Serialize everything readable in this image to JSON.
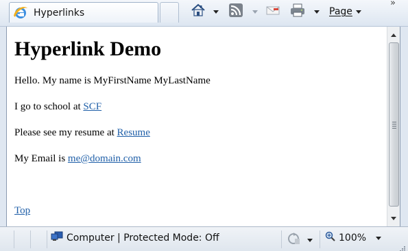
{
  "tab": {
    "title": "Hyperlinks",
    "icon": "ie-icon"
  },
  "toolbar": {
    "page_label": "Page",
    "overflow": "»",
    "icons": [
      "home-icon",
      "rss-feed-icon",
      "read-mail-icon",
      "print-icon"
    ]
  },
  "document": {
    "heading": "Hyperlink Demo",
    "intro": "Hello. My name is MyFirstName MyLastName",
    "school_prefix": "I go to school at ",
    "school_link": "SCF",
    "resume_prefix": "Please see my resume at ",
    "resume_link": "Resume",
    "email_prefix": "My Email is ",
    "email_link": "me@domain.com",
    "top_link": "Top"
  },
  "statusbar": {
    "zone_text": "Computer | Protected Mode: Off",
    "zoom": "100%"
  },
  "colors": {
    "link": "#1f5fa8",
    "chrome": "#dfe7f1"
  }
}
